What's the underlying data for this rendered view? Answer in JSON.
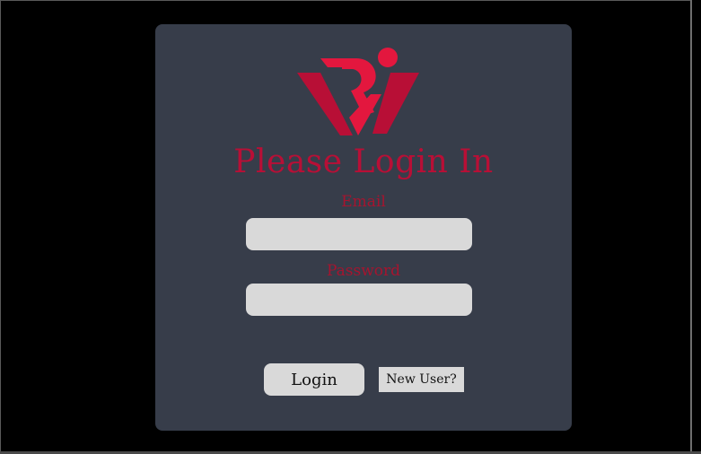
{
  "login": {
    "title": "Please Login In",
    "email_label": "Email",
    "email_value": "",
    "password_label": "Password",
    "password_value": "",
    "login_button": "Login",
    "new_user_button": "New User?"
  },
  "brand": {
    "logo_icon": "ri-monogram-logo",
    "colors": {
      "primary_red": "#e3173e",
      "dark_red": "#b80f36",
      "card_background": "#373d4a",
      "page_background": "#000000",
      "input_background": "#d9d9d9"
    }
  }
}
